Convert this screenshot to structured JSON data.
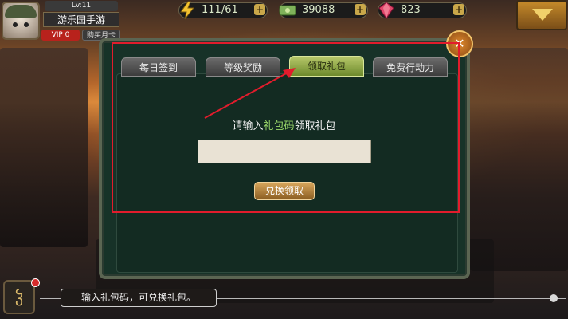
{
  "player": {
    "level": "Lv:11",
    "name": "游乐园手游",
    "vip": "VIP 0",
    "buy_card": "购买月卡"
  },
  "resources": {
    "energy": "111/61",
    "money": "39088",
    "gems": "823"
  },
  "tabs": [
    {
      "label": "每日签到"
    },
    {
      "label": "等级奖励"
    },
    {
      "label": "领取礼包",
      "active": true
    },
    {
      "label": "免费行动力"
    }
  ],
  "gift": {
    "prompt_pre": "请输入",
    "prompt_highlight": "礼包码",
    "prompt_post": "领取礼包",
    "input_value": "",
    "redeem_label": "兑换领取"
  },
  "bottom": {
    "message": "输入礼包码，可兑换礼包。"
  },
  "colors": {
    "highlight": "#9ad86a",
    "annotation": "#e21c2c",
    "active_tab": "#8faa3c"
  }
}
